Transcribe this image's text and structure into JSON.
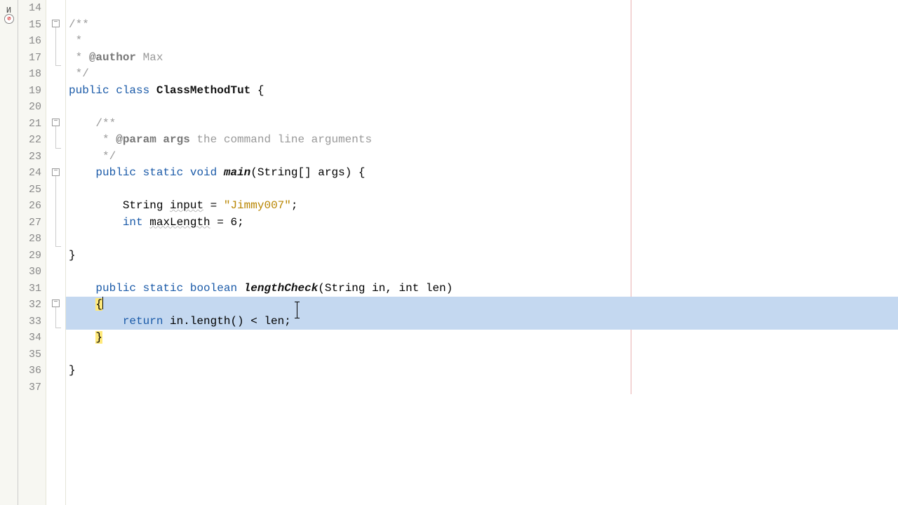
{
  "lines": {
    "start": 14,
    "end": 37
  },
  "code": {
    "l15_open": "/**",
    "l16_star": " *",
    "l17_star": " * ",
    "l17_tag": "@author",
    "l17_val": " Max",
    "l18_close": " */",
    "l19_public": "public",
    "l19_class": "class",
    "l19_name": "ClassMethodTut",
    "l19_brace": " {",
    "l21_open": "/**",
    "l22_star": " * ",
    "l22_tag": "@param",
    "l22_arg": " args",
    "l22_desc": " the command line arguments",
    "l23_close": " */",
    "l24_public": "public",
    "l24_static": "static",
    "l24_void": "void",
    "l24_main": "main",
    "l24_sig": "(String[] args) {",
    "l26_type": "String",
    "l26_var": "input",
    "l26_eq": " = ",
    "l26_str": "\"Jimmy007\"",
    "l26_semi": ";",
    "l27_type": "int",
    "l27_var": "maxLength",
    "l27_rest": " = 6;",
    "l29_brace": "}",
    "l31_public": "public",
    "l31_static": "static",
    "l31_boolean": "boolean",
    "l31_name": "lengthCheck",
    "l31_sig": "(String in, int len)",
    "l32_brace": "{",
    "l33_return": "return",
    "l33_expr1": " in.length() < len",
    "l33_semi": ";",
    "l34_brace": "}",
    "l36_brace": "}"
  },
  "indent": {
    "s4": "    ",
    "s8": "        ",
    "s12": "            "
  }
}
